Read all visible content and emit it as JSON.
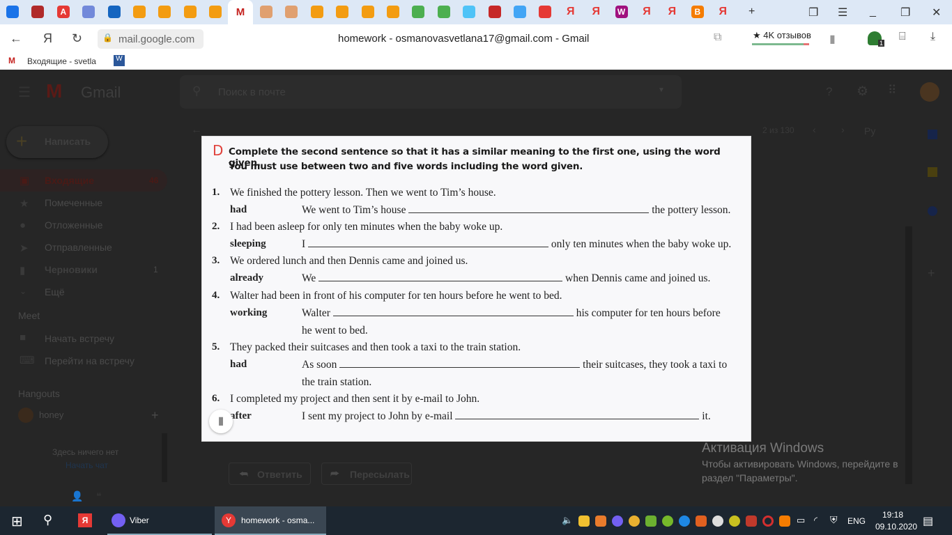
{
  "browser": {
    "tabs": [
      {
        "icon": "messages-icon",
        "color": "#1a73e8"
      },
      {
        "icon": "anarchy-icon",
        "color": "#b02a2a"
      },
      {
        "icon": "a-icon",
        "color": "#e53935",
        "glyph": "A"
      },
      {
        "icon": "discord-icon",
        "color": "#7289da"
      },
      {
        "icon": "mail-x-icon",
        "color": "#1565c0"
      },
      {
        "icon": "cloud-icon",
        "color": "#f39c12"
      },
      {
        "icon": "cloud-icon",
        "color": "#f39c12"
      },
      {
        "icon": "cloud-icon",
        "color": "#f39c12"
      },
      {
        "icon": "cloud-icon",
        "color": "#f39c12"
      },
      {
        "icon": "gmail-icon",
        "color": "#c5221f",
        "glyph": "M",
        "active": true
      },
      {
        "icon": "wheel-icon",
        "color": "#e0a070"
      },
      {
        "icon": "wheel-icon",
        "color": "#e0a070"
      },
      {
        "icon": "cloud-icon",
        "color": "#f39c12"
      },
      {
        "icon": "cloud-icon",
        "color": "#f39c12"
      },
      {
        "icon": "cloud-icon",
        "color": "#f39c12"
      },
      {
        "icon": "cloud-icon",
        "color": "#f39c12"
      },
      {
        "icon": "book-icon",
        "color": "#4caf50"
      },
      {
        "icon": "book-icon",
        "color": "#4caf50"
      },
      {
        "icon": "photo-icon",
        "color": "#4fc3f7"
      },
      {
        "icon": "apple-icon",
        "color": "#c62828"
      },
      {
        "icon": "gdz-icon",
        "color": "#42a5f5"
      },
      {
        "icon": "youtube-icon",
        "color": "#e53935"
      },
      {
        "icon": "yandex-icon",
        "color": "#e53935",
        "glyph": "Я"
      },
      {
        "icon": "yandex-icon",
        "color": "#e53935",
        "glyph": "Я"
      },
      {
        "icon": "w-icon",
        "color": "#a0117f",
        "glyph": "W"
      },
      {
        "icon": "yandex-icon",
        "color": "#e53935",
        "glyph": "Я"
      },
      {
        "icon": "yandex-icon",
        "color": "#e53935",
        "glyph": "Я"
      },
      {
        "icon": "blogger-icon",
        "color": "#f57c00",
        "glyph": "B"
      },
      {
        "icon": "yandex-icon",
        "color": "#e53935",
        "glyph": "Я"
      }
    ],
    "url": "mail.google.com",
    "page_title": "homework - osmanovasvetlana17@gmail.com - Gmail",
    "reviews": "★ 4K отзывов",
    "bookmark": "Входящие - svetla",
    "extension_badge": "1"
  },
  "gmail": {
    "logo": "Gmail",
    "search_placeholder": "Поиск в почте",
    "compose": "Написать",
    "nav": [
      {
        "label": "Входящие",
        "count": "46"
      },
      {
        "label": "Помеченные"
      },
      {
        "label": "Отложенные"
      },
      {
        "label": "Отправленные"
      },
      {
        "label": "Черновики",
        "count": "1"
      },
      {
        "label": "Ещё"
      }
    ],
    "meet_title": "Meet",
    "meet": [
      "Начать встречу",
      "Перейти на встречу"
    ],
    "hangouts_title": "Hangouts",
    "hangouts_user": "honey",
    "empty": "Здесь ничего нет",
    "start_chat": "Начать чат",
    "pager": "2 из 130",
    "lang": "Ру",
    "reply": "Ответить",
    "forward": "Пересылать"
  },
  "exercise": {
    "letter": "D",
    "instruction1": "Complete the second sentence so that it has a similar meaning to the first one, using the word given.",
    "instruction2": "You must use between two and five words including the word given.",
    "items": [
      {
        "n": "1.",
        "s": "We finished the pottery lesson. Then we went to Tim’s house.",
        "kw": "had",
        "pre": "We went to Tim’s house",
        "post": "the pottery lesson."
      },
      {
        "n": "2.",
        "s": "I had been asleep for only ten minutes when the baby woke up.",
        "kw": "sleeping",
        "pre": "I",
        "post": "only ten minutes when the baby woke up."
      },
      {
        "n": "3.",
        "s": "We ordered lunch and then Dennis came and joined us.",
        "kw": "already",
        "pre": "We",
        "post": "when Dennis came and joined us."
      },
      {
        "n": "4.",
        "s": "Walter had been in front of his computer for ten hours before he went to bed.",
        "kw": "working",
        "pre": "Walter",
        "post": "his computer for ten hours before",
        "cont": "he went to bed."
      },
      {
        "n": "5.",
        "s": "They packed their suitcases and then took a taxi to the train station.",
        "kw": "had",
        "pre": "As soon",
        "post": "their suitcases, they took a taxi to",
        "cont": "the train station."
      },
      {
        "n": "6.",
        "s": "I completed my project and then sent it by e-mail to John.",
        "kw": "after",
        "pre": "I sent my project to John by e-mail",
        "post": "it."
      }
    ]
  },
  "watermark": {
    "title": "Активация Windows",
    "text1": "Чтобы активировать Windows, перейдите в",
    "text2": "раздел \"Параметры\"."
  },
  "taskbar": {
    "apps": [
      {
        "label": "Viber"
      },
      {
        "label": "homework - osma..."
      }
    ],
    "lang": "ENG",
    "time": "19:18",
    "date": "09.10.2020"
  }
}
